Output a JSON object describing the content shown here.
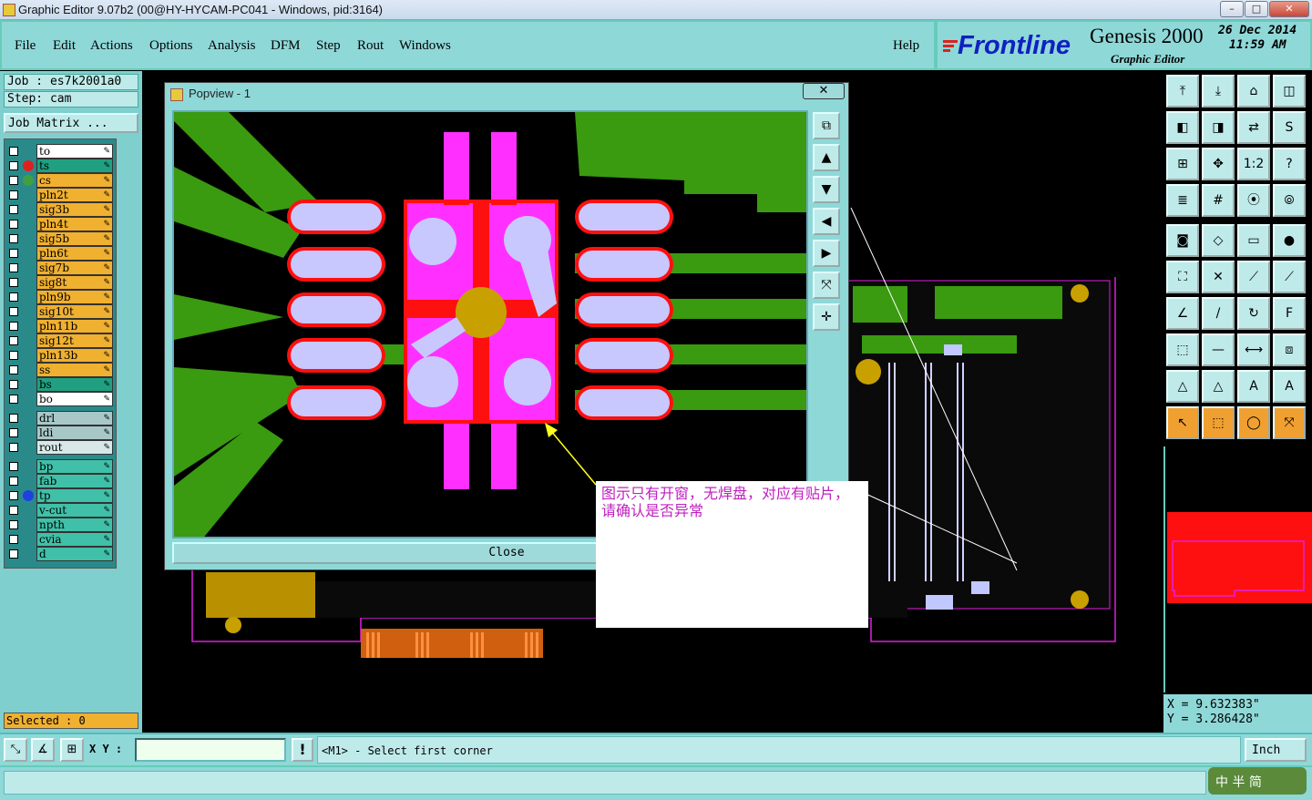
{
  "window": {
    "title": "Graphic Editor 9.07b2 (00@HY-HYCAM-PC041 - Windows, pid:3164)"
  },
  "menu": {
    "items": [
      "File",
      "Edit",
      "Actions",
      "Options",
      "Analysis",
      "DFM",
      "Step",
      "Rout",
      "Windows"
    ],
    "help": "Help"
  },
  "brand": {
    "logo": "Frontline",
    "product": "Genesis 2000",
    "subtitle": "Graphic Editor",
    "date": "26 Dec 2014",
    "time": "11:59 AM"
  },
  "job": {
    "job_label": "Job  : es7k2001a0",
    "step_label": "Step: cam",
    "matrix_button": "Job Matrix ..."
  },
  "layers": [
    {
      "name": "to",
      "bg": "#ffffff",
      "dot": ""
    },
    {
      "name": "ts",
      "bg": "#20a080",
      "dot": "#e02020"
    },
    {
      "name": "cs",
      "bg": "#f0b030",
      "dot": "#40a040"
    },
    {
      "name": "pln2t",
      "bg": "#f0b030",
      "dot": ""
    },
    {
      "name": "sig3b",
      "bg": "#f0b030",
      "dot": ""
    },
    {
      "name": "pln4t",
      "bg": "#f0b030",
      "dot": ""
    },
    {
      "name": "sig5b",
      "bg": "#f0b030",
      "dot": ""
    },
    {
      "name": "pln6t",
      "bg": "#f0b030",
      "dot": ""
    },
    {
      "name": "sig7b",
      "bg": "#f0b030",
      "dot": ""
    },
    {
      "name": "sig8t",
      "bg": "#f0b030",
      "dot": ""
    },
    {
      "name": "pln9b",
      "bg": "#f0b030",
      "dot": ""
    },
    {
      "name": "sig10t",
      "bg": "#f0b030",
      "dot": ""
    },
    {
      "name": "pln11b",
      "bg": "#f0b030",
      "dot": ""
    },
    {
      "name": "sig12t",
      "bg": "#f0b030",
      "dot": ""
    },
    {
      "name": "pln13b",
      "bg": "#f0b030",
      "dot": ""
    },
    {
      "name": "ss",
      "bg": "#f0b030",
      "dot": ""
    },
    {
      "name": "bs",
      "bg": "#20a080",
      "dot": ""
    },
    {
      "name": "bo",
      "bg": "#ffffff",
      "dot": ""
    }
  ],
  "drill_layers": [
    {
      "name": "drl",
      "bg": "#a8c8c8"
    },
    {
      "name": "ldi",
      "bg": "#a8c8c8"
    },
    {
      "name": "rout",
      "bg": "#d8e8e8"
    }
  ],
  "misc_layers": [
    {
      "name": "bp",
      "bg": "#40c0a8",
      "dot": ""
    },
    {
      "name": "fab",
      "bg": "#40c0a8",
      "dot": ""
    },
    {
      "name": "tp",
      "bg": "#40c0a8",
      "dot": "#2040e0"
    },
    {
      "name": "v-cut",
      "bg": "#40c0a8",
      "dot": ""
    },
    {
      "name": "npth",
      "bg": "#40c0a8",
      "dot": ""
    },
    {
      "name": "cvia",
      "bg": "#40c0a8",
      "dot": ""
    },
    {
      "name": "d",
      "bg": "#40c0a8",
      "dot": ""
    }
  ],
  "selected": "Selected : 0",
  "popview": {
    "title": "Popview - 1",
    "close_label": "Close"
  },
  "note": "图示只有开窗，无焊盘，对应有贴片，请确认是否异常",
  "coords": {
    "x": "X  =  9.632383\"",
    "y": "Y  =  3.286428\""
  },
  "status": {
    "xy_label": "X Y :",
    "xy_value": "",
    "message": "<M1> - Select first corner",
    "units": "Inch"
  },
  "ime": "中 半 简",
  "colors": {
    "panel": "#8fd8d8",
    "copper": "#3a9a10",
    "mask": "#ff30ff",
    "pad_red": "#ff1010",
    "silk": "#c8c8ff"
  }
}
